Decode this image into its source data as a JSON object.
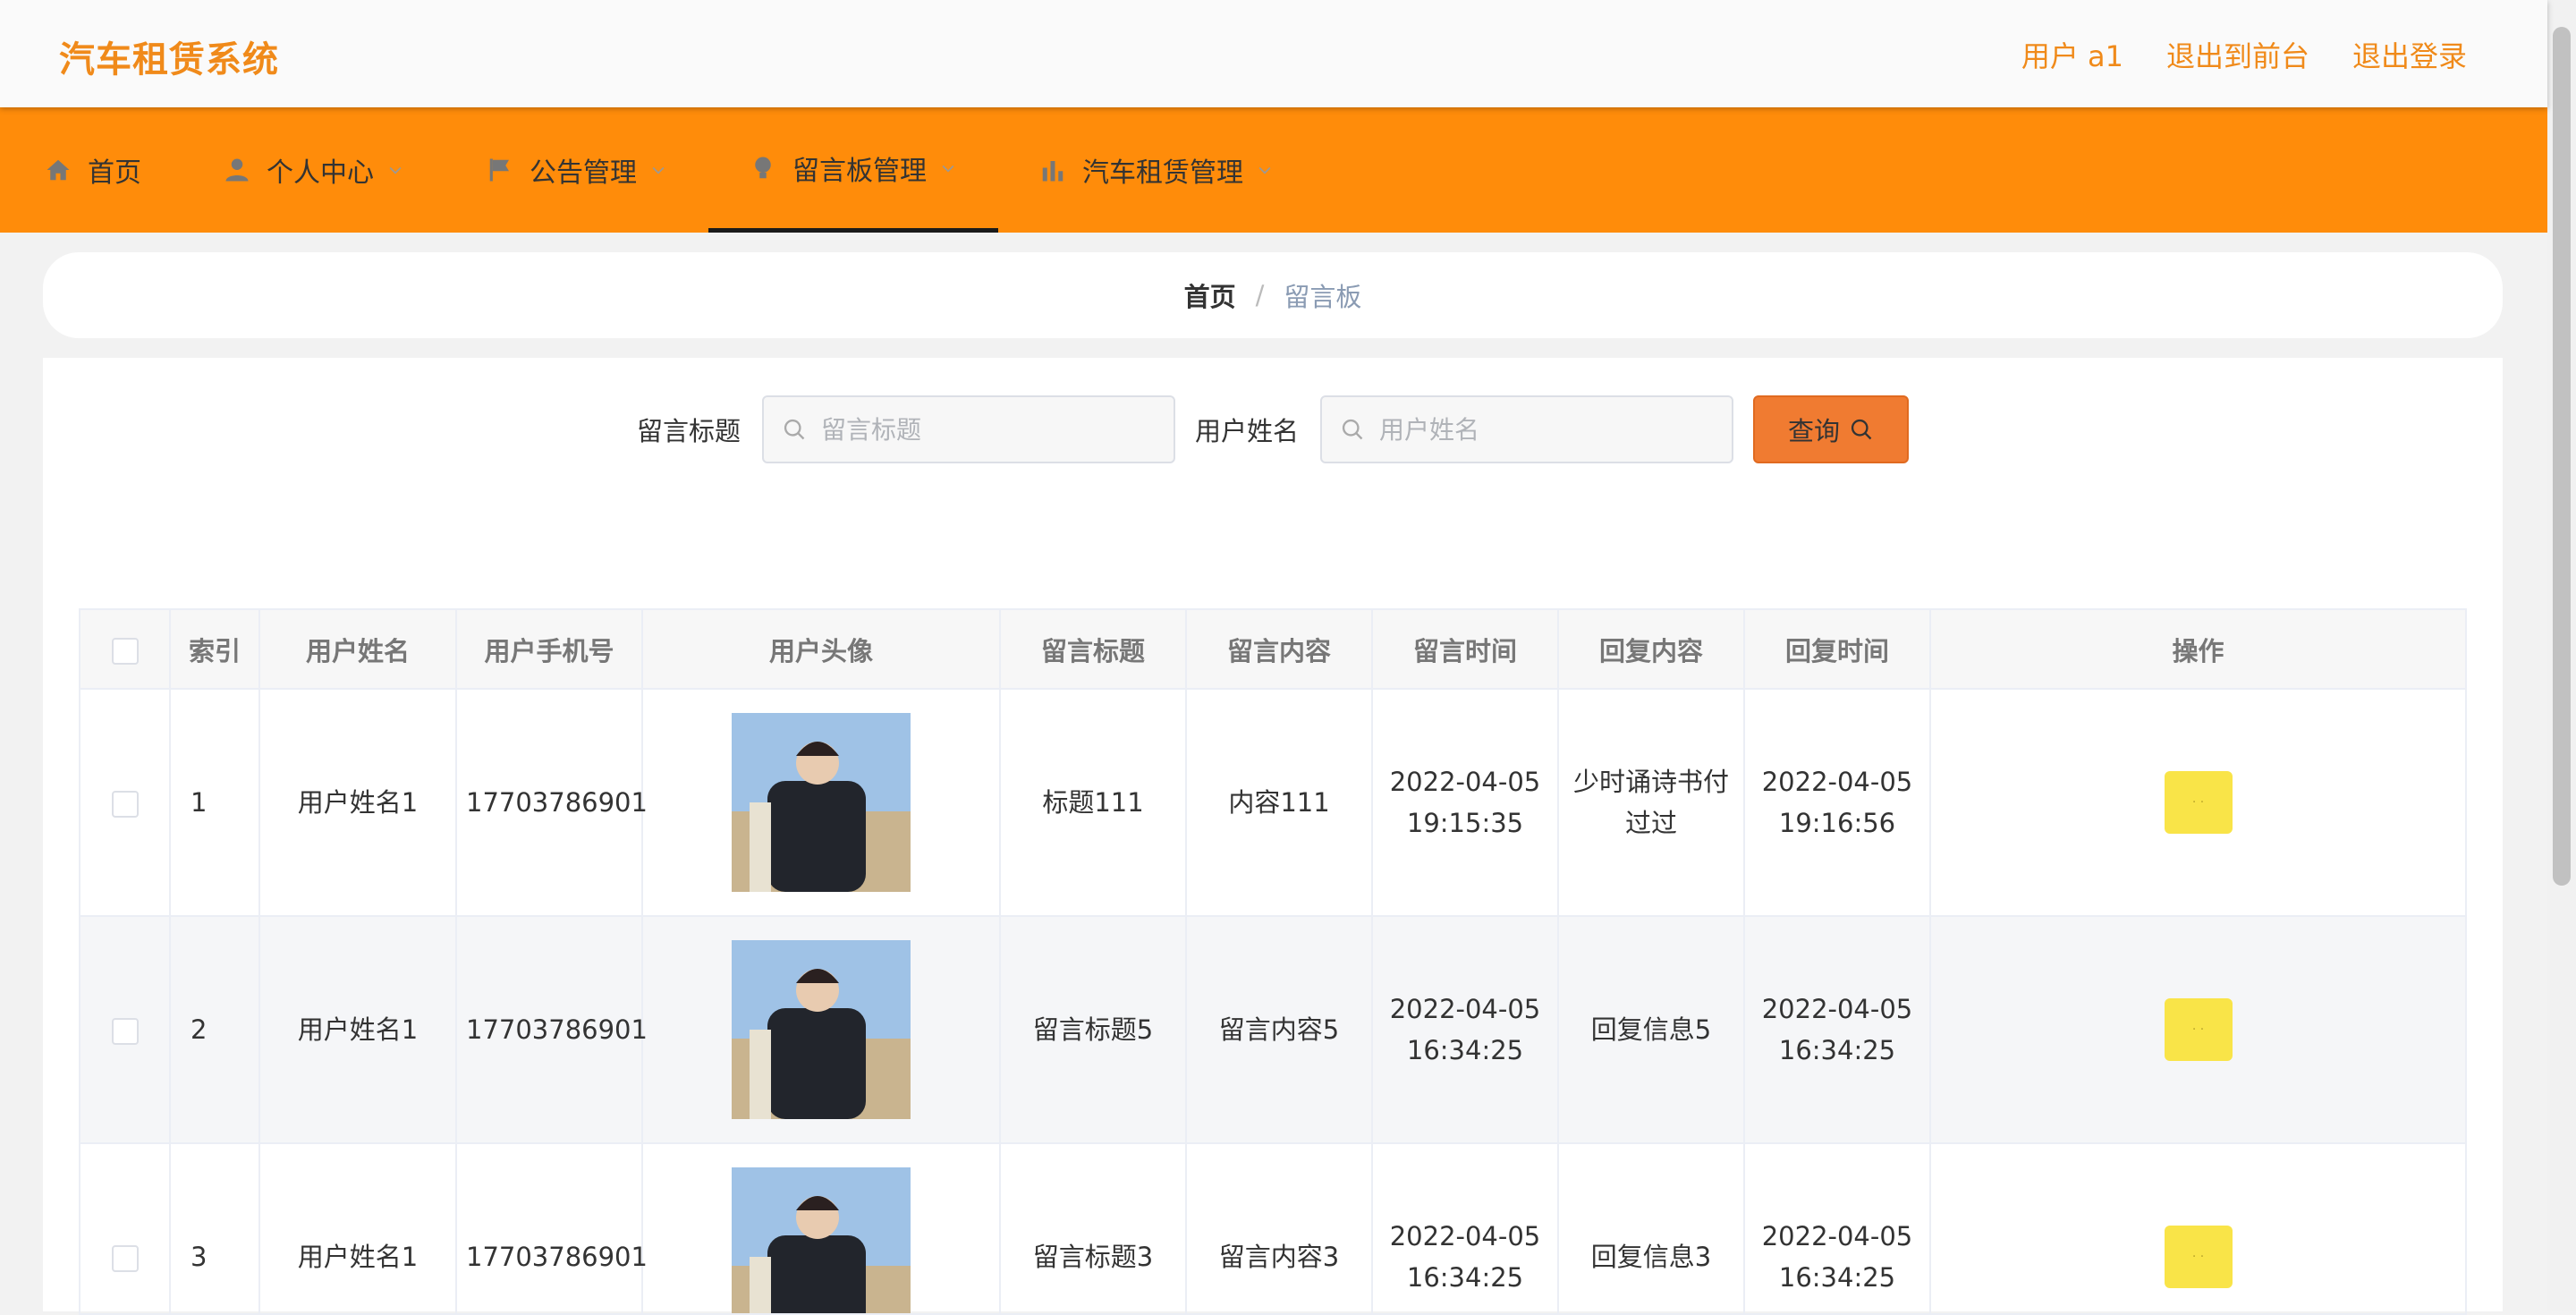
{
  "header": {
    "brand": "汽车租赁系统",
    "user_label": "用户 a1",
    "to_front": "退出到前台",
    "logout": "退出登录"
  },
  "nav": [
    {
      "label": "首页",
      "icon": "home-icon"
    },
    {
      "label": "个人中心",
      "icon": "user-icon"
    },
    {
      "label": "公告管理",
      "icon": "flag-icon"
    },
    {
      "label": "留言板管理",
      "icon": "lightbulb-icon"
    },
    {
      "label": "汽车租赁管理",
      "icon": "bar-chart-icon"
    }
  ],
  "breadcrumb": {
    "home": "首页",
    "separator": "/",
    "current": "留言板"
  },
  "search": {
    "title_label": "留言标题",
    "title_placeholder": "留言标题",
    "user_label": "用户姓名",
    "user_placeholder": "用户姓名",
    "query_label": "查询"
  },
  "table": {
    "headers": [
      "索引",
      "用户姓名",
      "用户手机号",
      "用户头像",
      "留言标题",
      "留言内容",
      "留言时间",
      "回复内容",
      "回复时间",
      "操作"
    ],
    "rows": [
      {
        "index": "1",
        "user_name": "用户姓名1",
        "phone": "17703786901",
        "title": "标题111",
        "content": "内容111",
        "time": "2022-04-05 19:15:35",
        "reply": "少时诵诗书付过过",
        "reply_time": "2022-04-05 19:16:56"
      },
      {
        "index": "2",
        "user_name": "用户姓名1",
        "phone": "17703786901",
        "title": "留言标题5",
        "content": "留言内容5",
        "time": "2022-04-05 16:34:25",
        "reply": "回复信息5",
        "reply_time": "2022-04-05 16:34:25"
      },
      {
        "index": "3",
        "user_name": "用户姓名1",
        "phone": "17703786901",
        "title": "留言标题3",
        "content": "留言内容3",
        "time": "2022-04-05 16:34:25",
        "reply": "回复信息3",
        "reply_time": "2022-04-05 16:34:25"
      }
    ]
  },
  "colors": {
    "brand": "#f08a1a",
    "nav_bg": "#ff8c0a",
    "query_btn": "#f07b31",
    "op_btn": "#f9e448"
  }
}
